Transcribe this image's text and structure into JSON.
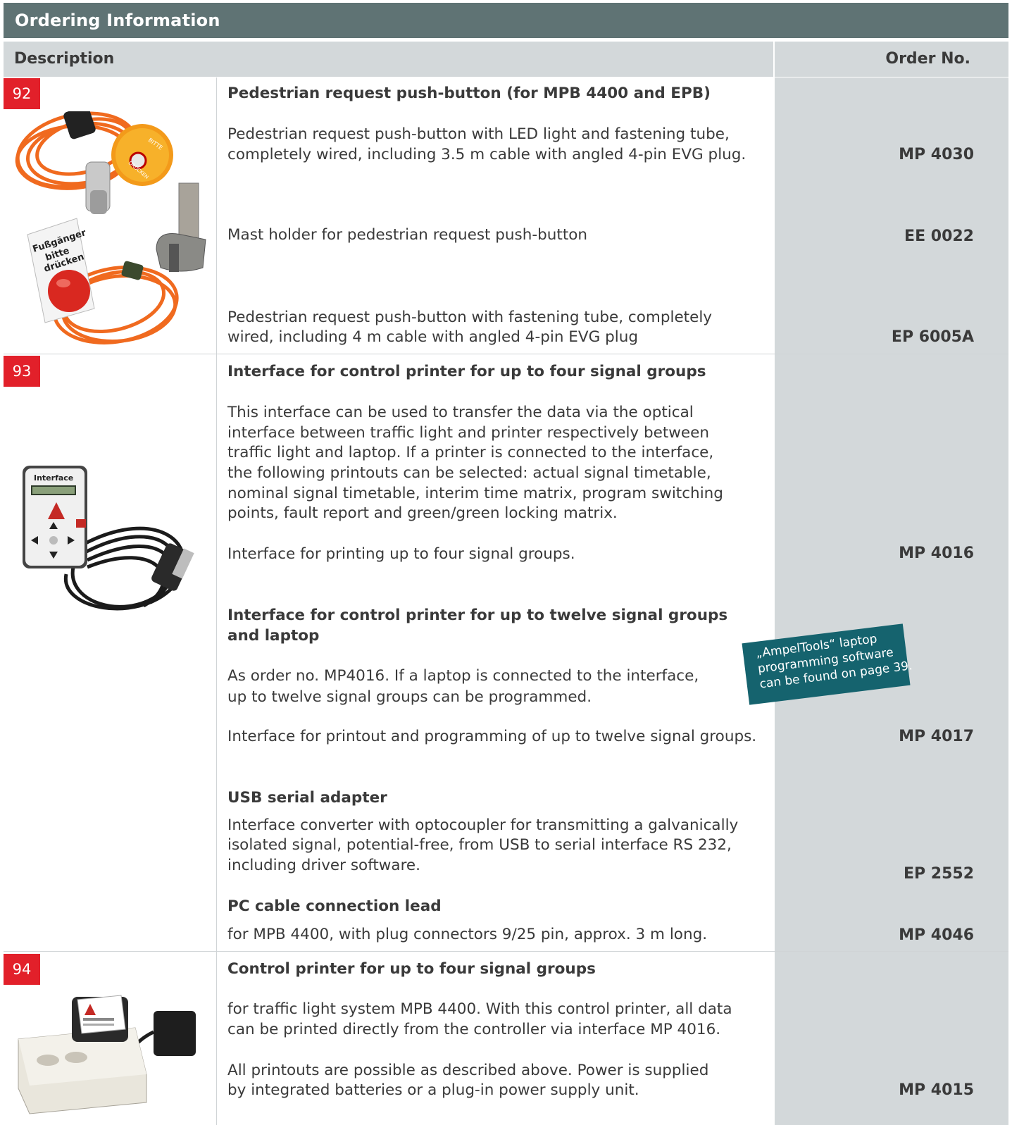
{
  "title": "Ordering Information",
  "header": {
    "description": "Description",
    "order_no": "Order No."
  },
  "sections": [
    {
      "number": "92",
      "heading": "Pedestrian request push-button (for MPB 4400 and EPB)",
      "items": [
        {
          "lines": [
            "Pedestrian request push-button with LED light and fastening tube,",
            "completely wired, including 3.5 m cable with angled 4-pin EVG plug."
          ],
          "order": "MP 4030"
        },
        {
          "lines": [
            "Mast holder for pedestrian request push-button"
          ],
          "order": "EE 0022"
        },
        {
          "lines": [
            "Pedestrian request push-button with fastening tube, completely",
            "wired, including 4 m cable with angled 4-pin EVG plug"
          ],
          "order": "EP 6005A"
        }
      ],
      "image_text": [
        "Fußgänger",
        "bitte",
        "drücken",
        "BITTE DRÜCKEN"
      ]
    },
    {
      "number": "93",
      "heading": "Interface for control printer for up to four signal groups",
      "intro": [
        "This interface can be used to transfer the data via the optical",
        "interface between traffic light and printer respectively between",
        "traffic light and laptop. If a printer is connected to the interface,",
        "the following printouts can be selected: actual signal timetable,",
        "nominal signal timetable, interim time matrix, program switching",
        "points, fault report and green/green locking matrix."
      ],
      "item1": {
        "text": "Interface for printing up to four signal groups.",
        "order": "MP 4016"
      },
      "heading2": [
        "Interface for control printer for up to twelve signal groups",
        "and laptop"
      ],
      "text2": [
        "As order no. MP4016. If a laptop is connected to the interface,",
        "up to twelve signal groups can be programmed."
      ],
      "item2": {
        "text": "Interface for printout and programming of up to twelve signal groups.",
        "order": "MP 4017"
      },
      "heading3": "USB serial adapter",
      "text3": [
        "Interface converter with optocoupler for transmitting a galvanically",
        "isolated signal, potential-free, from USB to serial interface RS 232,",
        "including driver software."
      ],
      "order3": "EP 2552",
      "heading4": "PC cable connection lead",
      "item4": {
        "text": "for MPB 4400, with plug connectors 9/25 pin, approx. 3 m long.",
        "order": "MP 4046"
      },
      "image_text": [
        "Interface"
      ]
    },
    {
      "number": "94",
      "heading": "Control printer for up to four signal groups",
      "text": [
        "for traffic light system MPB 4400. With this control printer, all data",
        "can be printed directly from the controller via interface MP 4016."
      ],
      "text2": [
        "All printouts are possible as described above. Power is supplied",
        "by integrated batteries or a plug-in power supply unit."
      ],
      "order": "MP 4015"
    }
  ],
  "note": [
    "„AmpelTools“ laptop",
    "programming software",
    "can be found on page 39."
  ],
  "colors": {
    "title_bg": "#5f7374",
    "header_bg": "#d3d8da",
    "badge": "#e2202a",
    "note_bg": "#15636e"
  }
}
